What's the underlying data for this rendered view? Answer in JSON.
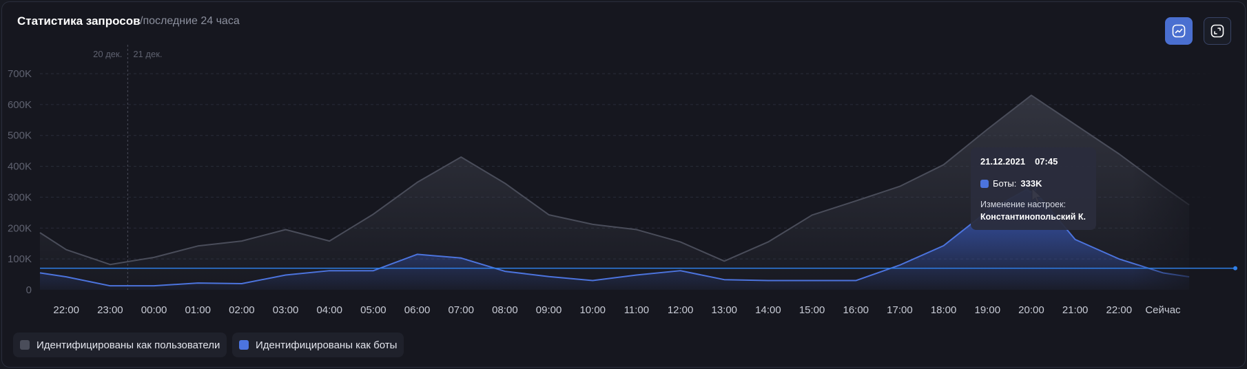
{
  "header": {
    "title": "Статистика запросов",
    "subtitle": "/последние 24 часа"
  },
  "toolbar": {
    "chart_button_icon": "line-chart-icon",
    "expand_button_icon": "expand-icon"
  },
  "legend": {
    "items": [
      {
        "label": "Идентифицированы как пользователи",
        "color": "#4a4d5a"
      },
      {
        "label": "Идентифицированы как боты",
        "color": "#4c74de"
      }
    ]
  },
  "tooltip": {
    "date": "21.12.2021",
    "time": "07:45",
    "series_label": "Боты:",
    "series_value": "333K",
    "note_label": "Изменение настроек:",
    "note_value": "Константинопольский К."
  },
  "colors": {
    "background": "#16171f",
    "users": "#4a4d5a",
    "bots": "#4c74de",
    "threshold": "#2f7fe8"
  },
  "chart_data": {
    "type": "area",
    "ylim": [
      0,
      700000
    ],
    "yticks": [
      {
        "value": 0,
        "label": "0"
      },
      {
        "value": 100000,
        "label": "100K"
      },
      {
        "value": 200000,
        "label": "200K"
      },
      {
        "value": 300000,
        "label": "300K"
      },
      {
        "value": 400000,
        "label": "400K"
      },
      {
        "value": 500000,
        "label": "500K"
      },
      {
        "value": 600000,
        "label": "600K"
      },
      {
        "value": 700000,
        "label": "700K"
      }
    ],
    "xlim": [
      -2.6,
      24.1
    ],
    "xticks": [
      {
        "x": -2,
        "label": "22:00"
      },
      {
        "x": -1,
        "label": "23:00"
      },
      {
        "x": 0,
        "label": "00:00"
      },
      {
        "x": 1,
        "label": "01:00"
      },
      {
        "x": 2,
        "label": "02:00"
      },
      {
        "x": 3,
        "label": "03:00"
      },
      {
        "x": 4,
        "label": "04:00"
      },
      {
        "x": 5,
        "label": "05:00"
      },
      {
        "x": 6,
        "label": "06:00"
      },
      {
        "x": 7,
        "label": "07:00"
      },
      {
        "x": 8,
        "label": "08:00"
      },
      {
        "x": 9,
        "label": "09:00"
      },
      {
        "x": 10,
        "label": "10:00"
      },
      {
        "x": 11,
        "label": "11:00"
      },
      {
        "x": 12,
        "label": "12:00"
      },
      {
        "x": 13,
        "label": "13:00"
      },
      {
        "x": 14,
        "label": "14:00"
      },
      {
        "x": 15,
        "label": "15:00"
      },
      {
        "x": 16,
        "label": "16:00"
      },
      {
        "x": 17,
        "label": "17:00"
      },
      {
        "x": 18,
        "label": "18:00"
      },
      {
        "x": 19,
        "label": "19:00"
      },
      {
        "x": 20,
        "label": "20:00"
      },
      {
        "x": 21,
        "label": "21:00"
      },
      {
        "x": 22,
        "label": "22:00"
      },
      {
        "x": 23,
        "label": "Сейчас"
      }
    ],
    "day_divider": {
      "x": -0.6,
      "left_label": "20 дек.",
      "right_label": "21 дек."
    },
    "threshold": 70000,
    "series": [
      {
        "name": "Идентифицированы как пользователи",
        "points": [
          [
            -2.6,
            185000
          ],
          [
            -2,
            130000
          ],
          [
            -1,
            82000
          ],
          [
            0,
            105000
          ],
          [
            1,
            142000
          ],
          [
            2,
            158000
          ],
          [
            3,
            195000
          ],
          [
            4,
            158000
          ],
          [
            5,
            245000
          ],
          [
            6,
            348000
          ],
          [
            7,
            430000
          ],
          [
            8,
            345000
          ],
          [
            9,
            243000
          ],
          [
            10,
            212000
          ],
          [
            11,
            195000
          ],
          [
            12,
            155000
          ],
          [
            13,
            93000
          ],
          [
            14,
            155000
          ],
          [
            15,
            242000
          ],
          [
            16,
            288000
          ],
          [
            17,
            335000
          ],
          [
            18,
            405000
          ],
          [
            19,
            520000
          ],
          [
            20,
            630000
          ],
          [
            21,
            535000
          ],
          [
            22,
            440000
          ],
          [
            23,
            335000
          ],
          [
            23.6,
            275000
          ]
        ]
      },
      {
        "name": "Идентифицированы как боты",
        "points": [
          [
            -2.6,
            55000
          ],
          [
            -2,
            42000
          ],
          [
            -1,
            13000
          ],
          [
            0,
            13000
          ],
          [
            1,
            22000
          ],
          [
            2,
            20000
          ],
          [
            3,
            48000
          ],
          [
            4,
            62000
          ],
          [
            5,
            62000
          ],
          [
            6,
            115000
          ],
          [
            7,
            103000
          ],
          [
            8,
            60000
          ],
          [
            9,
            43000
          ],
          [
            10,
            30000
          ],
          [
            11,
            48000
          ],
          [
            12,
            62000
          ],
          [
            13,
            33000
          ],
          [
            14,
            30000
          ],
          [
            15,
            30000
          ],
          [
            16,
            30000
          ],
          [
            17,
            80000
          ],
          [
            18,
            143000
          ],
          [
            19,
            255000
          ],
          [
            20,
            333000
          ],
          [
            21,
            163000
          ],
          [
            22,
            100000
          ],
          [
            23,
            55000
          ],
          [
            23.6,
            42000
          ]
        ]
      }
    ],
    "highlight": {
      "series": 1,
      "x": 20,
      "value": 333000
    }
  }
}
